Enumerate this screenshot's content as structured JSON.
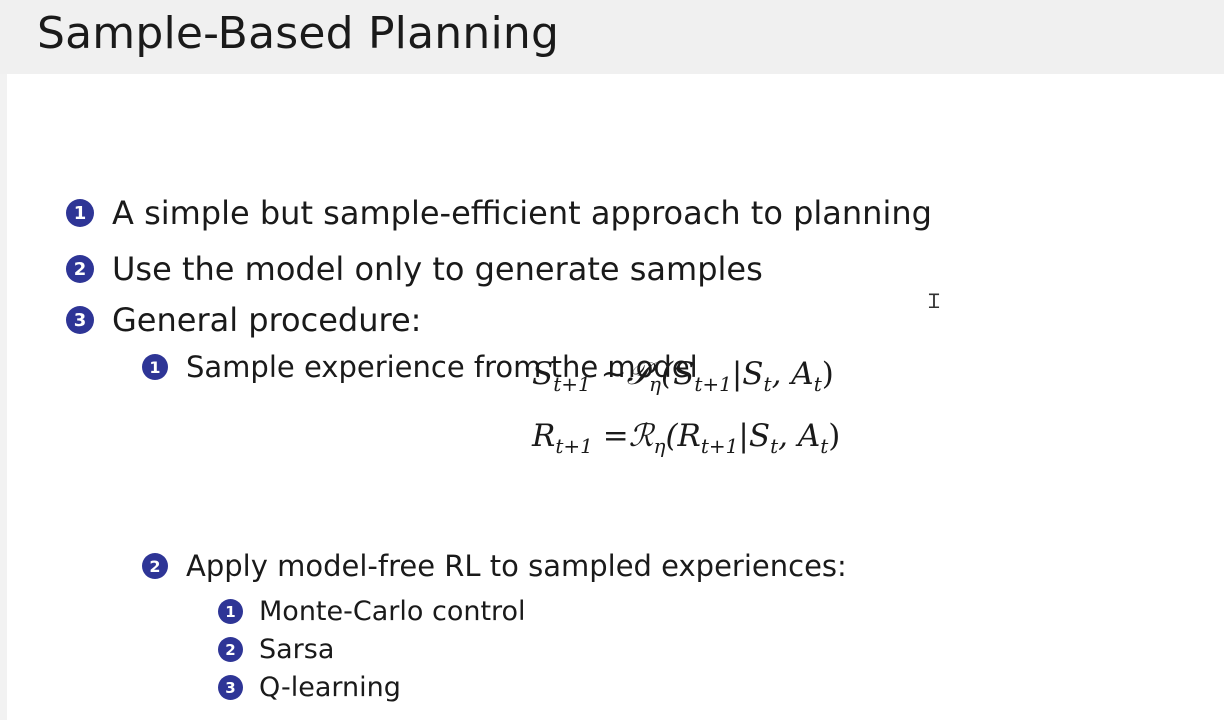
{
  "slide": {
    "title": "Sample-Based Planning"
  },
  "bullets": [
    {
      "number": "1",
      "text": "A simple but sample-efficient approach to planning"
    },
    {
      "number": "2",
      "text": "Use the model only to generate samples"
    },
    {
      "number": "3",
      "text": "General procedure:"
    }
  ],
  "procedure": [
    {
      "number": "1",
      "text": "Sample experience from the model"
    },
    {
      "number": "2",
      "text": "Apply model-free RL to sampled experiences:"
    }
  ],
  "equations": [
    {
      "lhs": "S",
      "lhs_sub": "t+1",
      "rel": " ~",
      "fn": "𝒫",
      "fn_sub": "η",
      "arg": "(S",
      "arg_sub": "t+1",
      "cond": "|S",
      "cond_sub": "t",
      "sep": ", A",
      "sep_sub": "t",
      "close": ")"
    },
    {
      "lhs": "R",
      "lhs_sub": "t+1",
      "rel": " =",
      "fn": "ℛ",
      "fn_sub": "η",
      "arg": "(R",
      "arg_sub": "t+1",
      "cond": "|S",
      "cond_sub": "t",
      "sep": ", A",
      "sep_sub": "t",
      "close": ")"
    }
  ],
  "methods": [
    {
      "number": "1",
      "text": "Monte-Carlo control"
    },
    {
      "number": "2",
      "text": "Sarsa"
    },
    {
      "number": "3",
      "text": "Q-learning"
    }
  ],
  "colors": {
    "badge": "#2e3596",
    "header_bg": "#f0f0f0",
    "content_bg": "#ffffff"
  },
  "cursor": {
    "icon": "text-cursor-icon"
  }
}
